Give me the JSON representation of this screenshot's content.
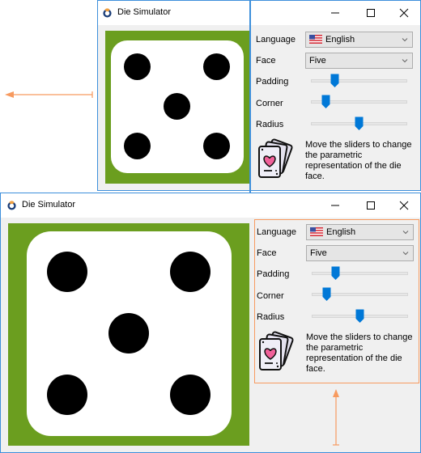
{
  "window_title": "Die Simulator",
  "app_icon": "die-simulator-app-icon",
  "title_controls": {
    "minimize": "minimize-icon",
    "maximize": "maximize-icon",
    "close": "close-icon"
  },
  "colors": {
    "die_background": "#6b9e1f",
    "die_face": "#ffffff",
    "pip": "#000000",
    "slider_thumb": "#0078d7",
    "window_border": "#3d8fdb",
    "annotation": "#f79a5f"
  },
  "controls": {
    "language_label": "Language",
    "language_value": "English",
    "language_flag": "us-flag-icon",
    "face_label": "Face",
    "face_value": "Five",
    "padding_label": "Padding",
    "corner_label": "Corner",
    "radius_label": "Radius",
    "padding_value_fraction": 0.22,
    "corner_value_fraction": 0.12,
    "radius_value_fraction": 0.5,
    "help_text_lines": [
      "Move the sliders to change",
      "the parametric",
      "representation of the die",
      "face."
    ],
    "help_icon": "playing-cards-heart-icon"
  },
  "die": {
    "face_value": 5,
    "pip_count": 5
  },
  "annotations": {
    "top_arrow": "arrow-left",
    "bottom_arrow": "arrow-up"
  }
}
